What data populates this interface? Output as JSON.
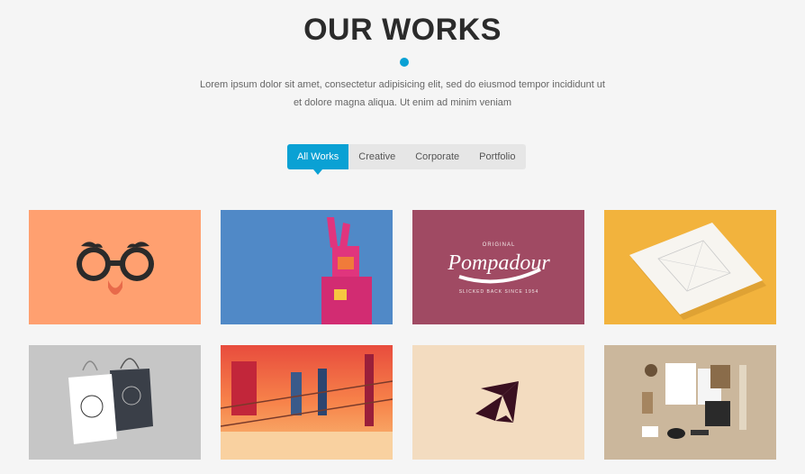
{
  "header": {
    "title": "OUR WORKS",
    "description_line1": "Lorem ipsum dolor sit amet, consectetur adipisicing elit, sed do eiusmod tempor incididunt ut",
    "description_line2": "et dolore magna aliqua. Ut enim ad minim veniam",
    "accent_color": "#0aa1d4"
  },
  "filters": [
    {
      "label": "All Works",
      "active": true
    },
    {
      "label": "Creative",
      "active": false
    },
    {
      "label": "Corporate",
      "active": false
    },
    {
      "label": "Portfolio",
      "active": false
    }
  ],
  "portfolio": {
    "items": [
      {
        "name": "glasses-disguise-illustration",
        "bg": "#ffa070"
      },
      {
        "name": "pink-rabbit-costume-illustration",
        "bg": "#4a84c4"
      },
      {
        "name": "pompadour-logo",
        "bg": "#a04a63",
        "logo_text": "Pompadour",
        "logo_top": "ORIGINAL",
        "logo_bottom": "SLICKED BACK SINCE 1954"
      },
      {
        "name": "paper-mockup",
        "bg": "#f2b33d"
      },
      {
        "name": "shopping-bags-mockup",
        "bg": "#c6c6c6"
      },
      {
        "name": "sunset-city-illustration",
        "bg": "#f08a50"
      },
      {
        "name": "abstract-bird-logo",
        "bg": "#f3dcc0"
      },
      {
        "name": "stationery-branding-mockup",
        "bg": "#cbb79c"
      }
    ]
  }
}
